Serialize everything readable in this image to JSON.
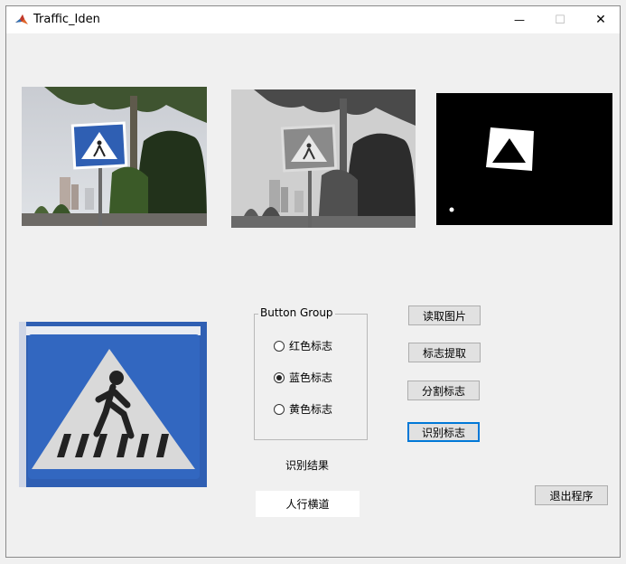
{
  "window": {
    "title": "Traffic_Iden",
    "controls": {
      "minimize": "—",
      "maximize": "☐",
      "close": "✕"
    }
  },
  "panels": {
    "original_image": "original-street-photo",
    "gray_image": "grayscale-street-photo",
    "binary_image": "binary-mask",
    "extracted_sign": "pedestrian-crossing-sign"
  },
  "radio_group": {
    "title": "Button Group",
    "options": [
      {
        "label": "红色标志",
        "checked": false
      },
      {
        "label": "蓝色标志",
        "checked": true
      },
      {
        "label": "黄色标志",
        "checked": false
      }
    ]
  },
  "buttons": {
    "read_image": "读取图片",
    "extract_sign": "标志提取",
    "segment_sign": "分割标志",
    "recognize_sign": "识别标志",
    "exit": "退出程序"
  },
  "result": {
    "label": "识别结果",
    "value": "人行横道"
  },
  "colors": {
    "sign_blue": "#2f5fb3",
    "window_bg": "#f0f0f0",
    "focus_border": "#0078d7"
  }
}
